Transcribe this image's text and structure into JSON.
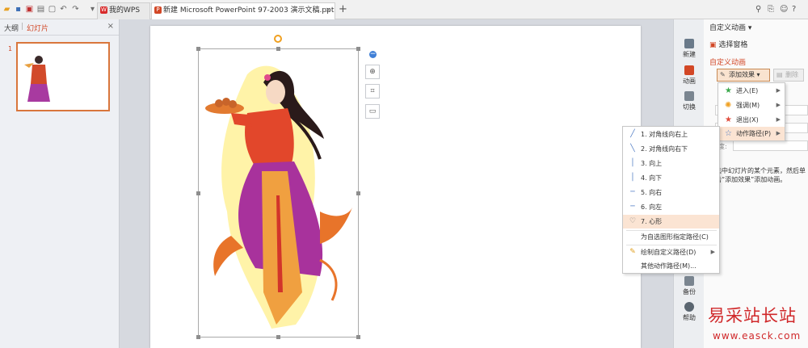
{
  "tabs": [
    {
      "label": "我的WPS",
      "icon": "wps-logo-icon"
    },
    {
      "label": "新建 Microsoft PowerPoint 97-2003 演示文稿.ppt *",
      "icon": "ppt-file-icon"
    }
  ],
  "add_tab": "+",
  "left_panel": {
    "outline_tab": "大纲",
    "separator": "|",
    "slides_tab": "幻灯片",
    "close": "×",
    "slide_number": "1"
  },
  "side_strip": {
    "items": [
      {
        "label": "新建"
      },
      {
        "label": "动画"
      },
      {
        "label": "切换"
      },
      {
        "label": "备份"
      },
      {
        "label": "帮助"
      }
    ]
  },
  "task_pane": {
    "title": "自定义动画 ▾",
    "select_pane": "选择窗格",
    "subtitle": "自定义动画",
    "add_effect": "添加效果 ▾",
    "delete": "删除",
    "speed_prefix": "速度:",
    "hint": "选中幻灯片的某个元素，然后单击“添加效果”添加动画。"
  },
  "effect_menu": [
    {
      "label": "进入(E)",
      "color": "#3aa84b"
    },
    {
      "label": "强调(M)",
      "color": "#f0a020"
    },
    {
      "label": "退出(X)",
      "color": "#e04c3c"
    },
    {
      "label": "动作路径(P)",
      "color": "#4a78c2"
    }
  ],
  "path_menu": {
    "items": [
      {
        "label": "1. 对角线向右上",
        "icon": "diagonal-up-right-icon"
      },
      {
        "label": "2. 对角线向右下",
        "icon": "diagonal-down-right-icon"
      },
      {
        "label": "3. 向上",
        "icon": "line-up-icon"
      },
      {
        "label": "4. 向下",
        "icon": "line-down-icon"
      },
      {
        "label": "5. 向右",
        "icon": "line-right-icon"
      },
      {
        "label": "6. 向左",
        "icon": "line-left-icon"
      },
      {
        "label": "7. 心形",
        "icon": "heart-path-icon"
      }
    ],
    "custom_shape": "为自选图形指定路径(C)",
    "draw_custom": "绘制自定义路径(D)",
    "more": "其他动作路径(M)..."
  },
  "watermark": {
    "cn": "易采站长站",
    "url": "www.easck.com"
  },
  "colors": {
    "accent": "#d24726",
    "highlight": "#fbe4d3"
  }
}
